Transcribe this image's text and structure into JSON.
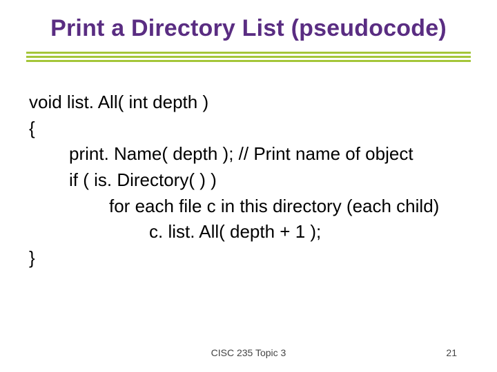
{
  "title": "Print a Directory List (pseudocode)",
  "code": {
    "l1": "void list. All( int depth )",
    "l2": "{",
    "l3": "print. Name( depth );   // Print name of object",
    "l4": "if ( is. Directory( ) )",
    "l5": "for each file c in this directory (each child)",
    "l6": "c. list. All( depth + 1 );",
    "l7": "}"
  },
  "footer": {
    "center": "CISC 235 Topic 3",
    "page": "21"
  }
}
